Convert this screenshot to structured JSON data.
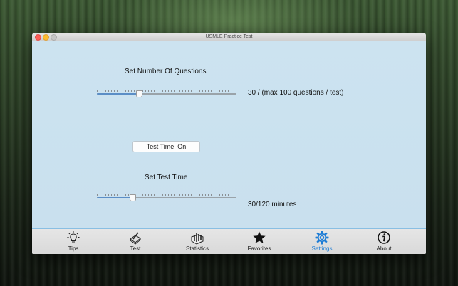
{
  "window": {
    "title": "USMLE Practice Test"
  },
  "questions": {
    "title": "Set Number Of Questions",
    "value_label": "30 / (max 100 questions / test)",
    "value": 30,
    "max": 100
  },
  "test_time_toggle": {
    "label": "Test Time: On"
  },
  "time": {
    "title": "Set Test Time",
    "value_label": "30/120 minutes",
    "value": 30,
    "max": 120
  },
  "tabs": [
    {
      "label": "Tips",
      "icon": "lightbulb-icon"
    },
    {
      "label": "Test",
      "icon": "pencil-paper-icon"
    },
    {
      "label": "Statistics",
      "icon": "statistics-icon"
    },
    {
      "label": "Favorites",
      "icon": "star-icon"
    },
    {
      "label": "Settings",
      "icon": "gear-icon",
      "active": true
    },
    {
      "label": "About",
      "icon": "info-icon"
    }
  ],
  "colors": {
    "accent": "#1e7dd6",
    "content_background": "#c8e0ee",
    "tabbar_border": "#89bfe3"
  }
}
